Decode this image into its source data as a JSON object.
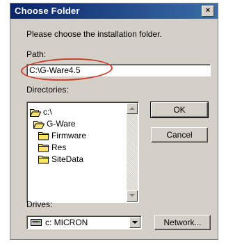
{
  "dialog": {
    "title": "Choose Folder",
    "close_label": "×",
    "instruction": "Please choose the installation folder.",
    "path_label": "Path:",
    "path_value": "C:\\G-Ware4.5",
    "directories_label": "Directories:",
    "directories": [
      {
        "name": "c:\\",
        "icon": "open-folder-icon",
        "indent": 0
      },
      {
        "name": "G-Ware",
        "icon": "open-folder-icon",
        "indent": 1
      },
      {
        "name": "Firmware",
        "icon": "folder-icon",
        "indent": 2
      },
      {
        "name": "Res",
        "icon": "folder-icon",
        "indent": 2
      },
      {
        "name": "SiteData",
        "icon": "folder-icon",
        "indent": 2
      }
    ],
    "ok_label": "OK",
    "cancel_label": "Cancel",
    "drives_label": "Drives:",
    "drive_value": "c: MICRON",
    "network_label": "Network...",
    "highlight_color": "#c8402e"
  }
}
